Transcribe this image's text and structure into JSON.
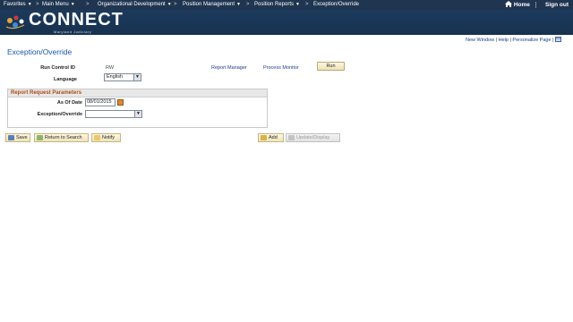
{
  "topnav": {
    "items": [
      {
        "label": "Favorites",
        "has_caret": true
      },
      {
        "label": "Main Menu",
        "has_caret": true
      },
      {
        "label": "Organizational Development",
        "has_caret": true
      },
      {
        "label": "Position Management",
        "has_caret": true
      },
      {
        "label": "Position Reports",
        "has_caret": true
      },
      {
        "label": "Exception/Override",
        "has_caret": false
      }
    ],
    "separator": ">",
    "home_label": "Home",
    "signout_label": "Sign out"
  },
  "banner": {
    "logo_text": "CONNECT",
    "logo_subtext": "Maryland Judiciary"
  },
  "utility_links": {
    "new_window": "New Window",
    "help": "Help",
    "personalize": "Personalize Page",
    "pipe": "|"
  },
  "page": {
    "title": "Exception/Override"
  },
  "form": {
    "run_control_label": "Run Control ID",
    "run_control_value": "RW",
    "language_label": "Language",
    "language_value": "English",
    "report_manager": "Report Manager",
    "process_monitor": "Process Monitor",
    "run_button": "Run"
  },
  "params": {
    "group_title": "Report Request Parameters",
    "as_of_date_label": "As Of Date",
    "as_of_date_value": "08/01/2015",
    "exception_label": "Exception/Override",
    "exception_value": ""
  },
  "toolbar": {
    "save": "Save",
    "return_to_search": "Return to Search",
    "notify": "Notify",
    "add": "Add",
    "update_display": "Update/Display"
  },
  "colors": {
    "nav_bg": "#1f3550",
    "banner_bg": "#1d3a5c",
    "title_blue": "#1a57a8",
    "group_title": "#b04a17",
    "link_blue": "#1b3d8a"
  }
}
